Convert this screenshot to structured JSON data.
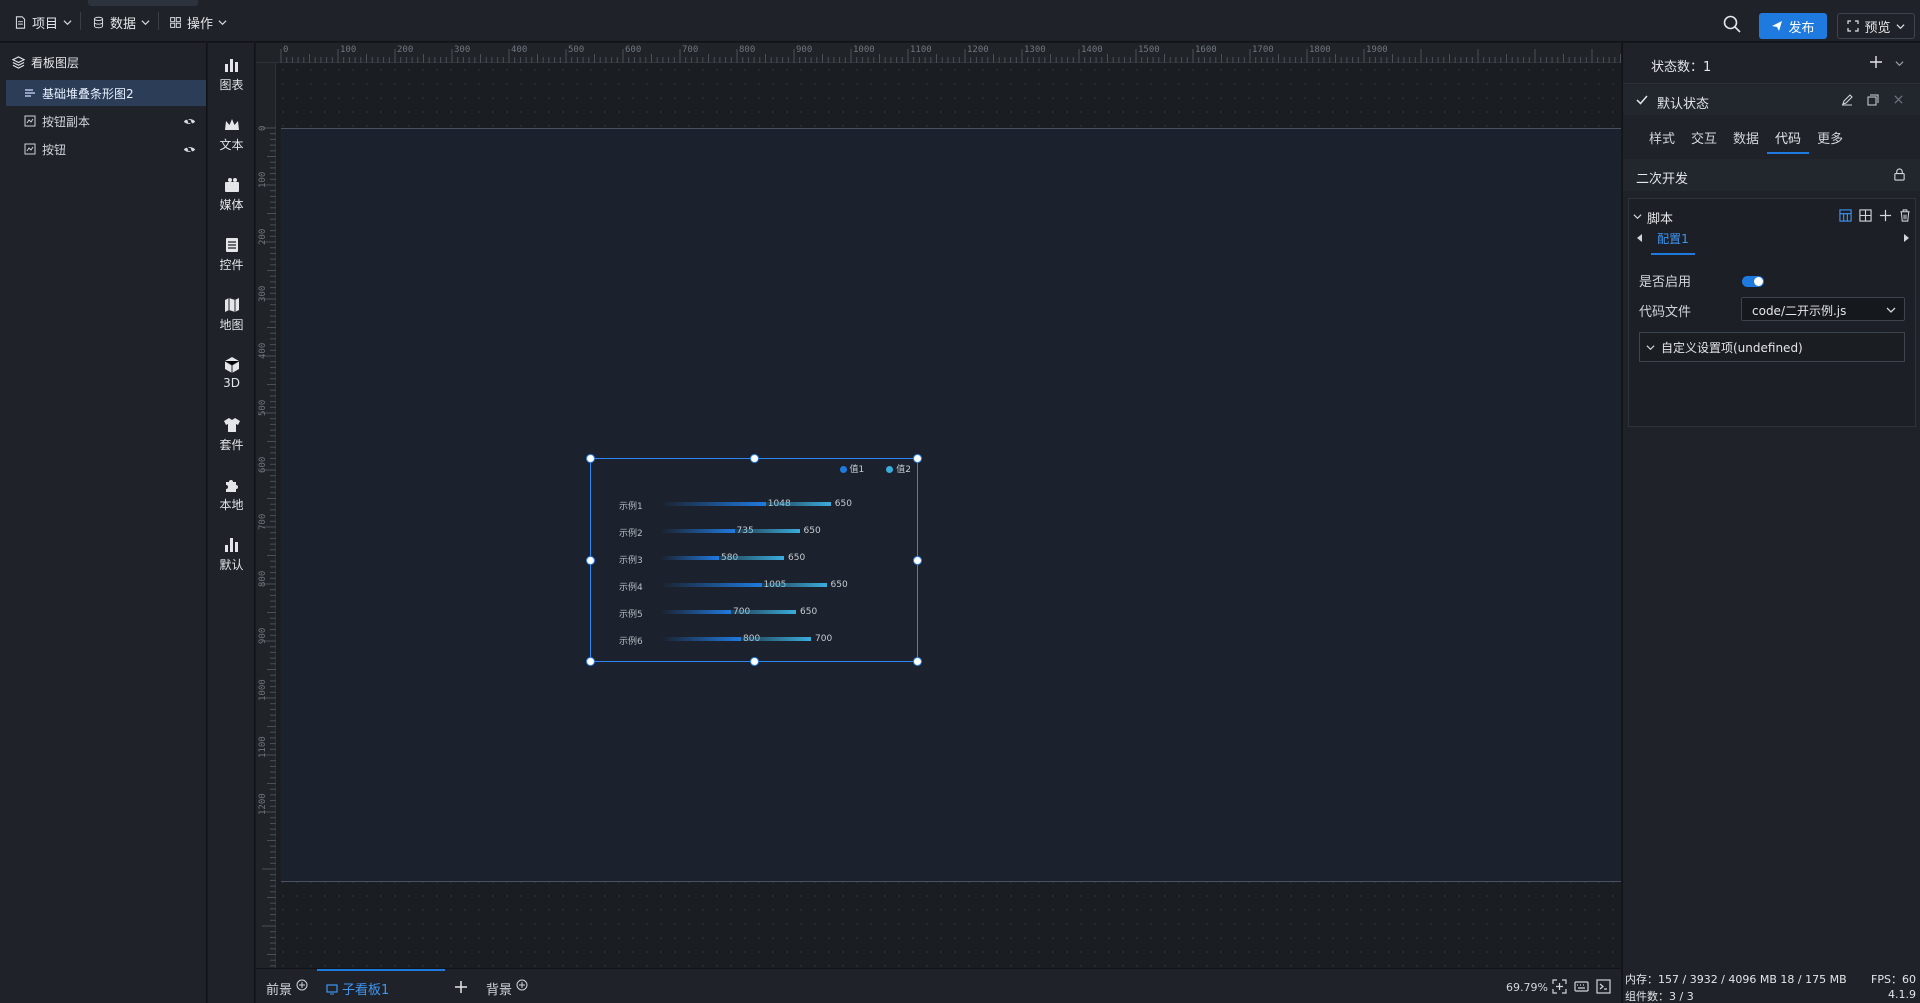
{
  "topbar": {
    "menus": [
      {
        "label": "项目",
        "icon": "document-icon"
      },
      {
        "label": "数据",
        "icon": "database-icon"
      },
      {
        "label": "操作",
        "icon": "grid-icon"
      }
    ],
    "publish_label": "发布",
    "preview_label": "预览"
  },
  "layers": {
    "title": "看板图层",
    "items": [
      {
        "label": "基础堆叠条形图2",
        "selected": true
      },
      {
        "label": "按钮副本",
        "selected": false
      },
      {
        "label": "按钮",
        "selected": false
      }
    ]
  },
  "components": [
    {
      "label": "图表",
      "icon": "bar-chart-icon"
    },
    {
      "label": "文本",
      "icon": "crown-icon"
    },
    {
      "label": "媒体",
      "icon": "media-icon"
    },
    {
      "label": "控件",
      "icon": "control-icon"
    },
    {
      "label": "地图",
      "icon": "map-icon"
    },
    {
      "label": "3D",
      "icon": "cube-icon"
    },
    {
      "label": "套件",
      "icon": "shirt-icon"
    },
    {
      "label": "本地",
      "icon": "puzzle-icon"
    },
    {
      "label": "默认",
      "icon": "default-chart-icon"
    }
  ],
  "ruler": {
    "top_labels": [
      "0",
      "100",
      "200",
      "300",
      "400",
      "500",
      "600",
      "700",
      "800",
      "900",
      "1000",
      "1100",
      "1200",
      "1300",
      "1400",
      "1500",
      "1600",
      "1700",
      "1800",
      "1900"
    ],
    "left_labels": [
      "0",
      "100",
      "200",
      "300",
      "400",
      "500",
      "600",
      "700",
      "800",
      "900",
      "1000",
      "1100",
      "1200"
    ]
  },
  "chart_data": {
    "type": "bar",
    "orientation": "horizontal",
    "stacked": true,
    "categories": [
      "示例1",
      "示例2",
      "示例3",
      "示例4",
      "示例5",
      "示例6"
    ],
    "series": [
      {
        "name": "值1",
        "values": [
          1048,
          735,
          580,
          1005,
          700,
          800
        ],
        "color": "#1f7ae0"
      },
      {
        "name": "值2",
        "values": [
          650,
          650,
          650,
          650,
          650,
          700
        ],
        "color": "#3aaddc"
      }
    ],
    "legend_position": "top-right",
    "grid": false
  },
  "bottombar": {
    "foreground_label": "前景",
    "sub_board_label": "子看板1",
    "background_label": "背景",
    "zoom": "69.79%"
  },
  "rightpanel": {
    "state_count": "状态数：1",
    "default_state": "默认状态",
    "tabs": [
      {
        "label": "样式",
        "active": false
      },
      {
        "label": "交互",
        "active": false
      },
      {
        "label": "数据",
        "active": false
      },
      {
        "label": "代码",
        "active": true
      },
      {
        "label": "更多",
        "active": false
      }
    ],
    "secondary_dev": "二次开发",
    "script_title": "脚本",
    "config_tab": "配置1",
    "enable_label": "是否启用",
    "enabled": true,
    "code_file_label": "代码文件",
    "code_file_value": "code/二开示例.js",
    "custom_settings": "自定义设置项(undefined)"
  },
  "status": {
    "memory": "内存：157 / 3932 / 4096 MB  18 / 175 MB",
    "fps": "FPS：60",
    "components": "组件数：3 / 3",
    "version": "4.1.9"
  },
  "colors": {
    "accent": "#1f7ae0",
    "bar2": "#3aaddc",
    "board": "#1b222d"
  }
}
